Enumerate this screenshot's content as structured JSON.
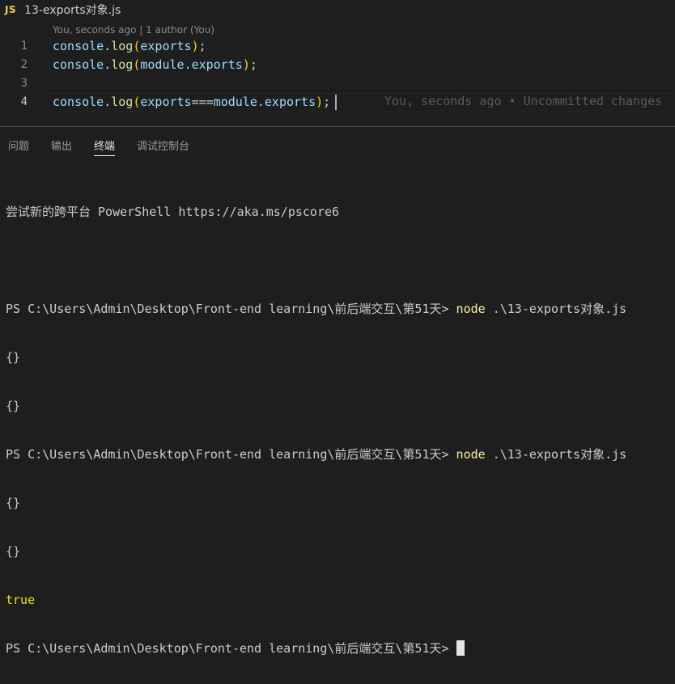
{
  "breadcrumb": {
    "icon_label": "JS",
    "file": "13-exports对象.js"
  },
  "codelens": "You, seconds ago | 1 author (You)",
  "lines": [
    {
      "number": "1",
      "obj": "console",
      "dot": ".",
      "fn": "log",
      "open": "(",
      "arg": "exports",
      "close": ")",
      "end": ";"
    },
    {
      "number": "2",
      "obj": "console",
      "dot": ".",
      "fn": "log",
      "open": "(",
      "arg": "module.exports",
      "close": ")",
      "end": ";"
    },
    {
      "number": "3"
    },
    {
      "number": "4",
      "obj": "console",
      "dot": ".",
      "fn": "log",
      "open": "(",
      "arg_a": "exports",
      "op": "===",
      "arg_b": "module.exports",
      "close": ")",
      "end": ";"
    }
  ],
  "blame": "You, seconds ago • Uncommitted changes",
  "tabs": [
    "问题",
    "输出",
    "终端",
    "调试控制台"
  ],
  "active_tab": "终端",
  "terminal": {
    "banner": "尝试新的跨平台 PowerShell https://aka.ms/pscore6",
    "prompt": "PS C:\\Users\\Admin\\Desktop\\Front-end learning\\前后端交互\\第51天> ",
    "cmd_node": "node",
    "cmd_arg": " .\\13-exports对象.js",
    "out_empty": "{}",
    "out_true": "true"
  }
}
